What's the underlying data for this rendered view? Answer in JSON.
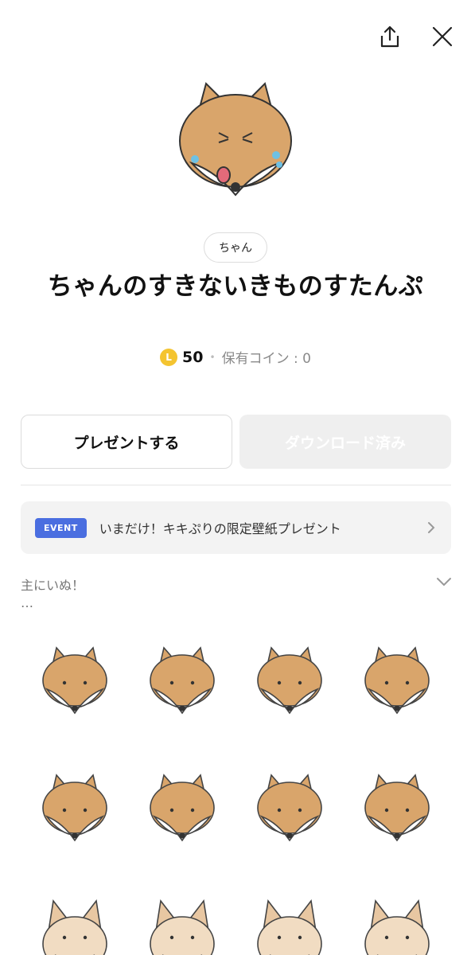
{
  "header": {
    "share_icon": "share-icon",
    "close_icon": "close-icon"
  },
  "author": "ちゃん",
  "title": "ちゃんのすきないきものすたんぷ",
  "price": {
    "coin_symbol": "L",
    "amount": "50",
    "separator": "•",
    "owned_label": "保有コイン : 0"
  },
  "buttons": {
    "gift": "プレゼントする",
    "download": "ダウンロード済み"
  },
  "event": {
    "badge": "EVENT",
    "text": "いまだけ！キキぷりの限定壁紙プレゼント"
  },
  "description": {
    "text": "主にいぬ！",
    "more": "…"
  },
  "colors": {
    "event_badge": "#4a6ee0",
    "coin": "#f4c430",
    "dog_body": "#d9a56b",
    "dog_face": "#ffffff"
  },
  "stickers": [
    {
      "name": "dog-tongue-sticker"
    },
    {
      "name": "dog-angry-sticker"
    },
    {
      "name": "dog-confused-sticker"
    },
    {
      "name": "dog-crying-sticker"
    },
    {
      "name": "dog-shivering-sticker"
    },
    {
      "name": "dog-arms-up-sticker"
    },
    {
      "name": "dog-running-sticker"
    },
    {
      "name": "dog-tongue-out-sticker"
    },
    {
      "name": "dog-humming-sticker"
    },
    {
      "name": "dog-sad-sticker"
    },
    {
      "name": "dog-eating-bread-sticker"
    },
    {
      "name": "dog-question-sticker"
    }
  ]
}
